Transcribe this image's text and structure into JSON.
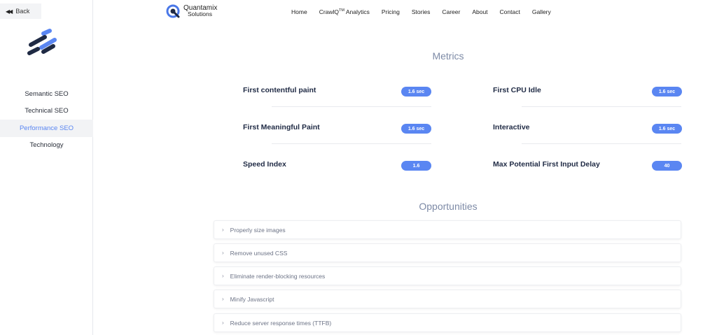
{
  "sidebar": {
    "back_label": "Back",
    "items": [
      {
        "label": "Semantic SEO"
      },
      {
        "label": "Technical SEO"
      },
      {
        "label": "Performance SEO"
      },
      {
        "label": "Technology"
      }
    ]
  },
  "header": {
    "brand_line1": "Quantamix",
    "brand_line2": "Solutions",
    "nav": {
      "home": "Home",
      "crawliq": "CrawlQ",
      "crawliq_sup": "TM",
      "crawliq_suffix": " Analytics",
      "pricing": "Pricing",
      "stories": "Stories",
      "career": "Career",
      "about": "About",
      "contact": "Contact",
      "gallery": "Gallery"
    }
  },
  "metrics": {
    "title": "Metrics",
    "items": [
      {
        "label": "First contentful paint",
        "value": "1.6 sec"
      },
      {
        "label": "First CPU Idle",
        "value": "1.6 sec"
      },
      {
        "label": "First Meaningful Paint",
        "value": "1.6 sec"
      },
      {
        "label": "Interactive",
        "value": "1.6 sec"
      },
      {
        "label": "Speed Index",
        "value": "1.6"
      },
      {
        "label": "Max Potential First Input Delay",
        "value": "40"
      }
    ]
  },
  "opportunities": {
    "title": "Opportunities",
    "items": [
      {
        "label": "Properly size images"
      },
      {
        "label": "Remove unused CSS"
      },
      {
        "label": "Eliminate render-blocking resources"
      },
      {
        "label": "Minify Javascript"
      },
      {
        "label": "Reduce server response times (TTFB)"
      }
    ]
  },
  "colors": {
    "accent": "#5a86f2",
    "logo_dark": "#1f2a44",
    "logo_blue": "#5a86f2"
  }
}
